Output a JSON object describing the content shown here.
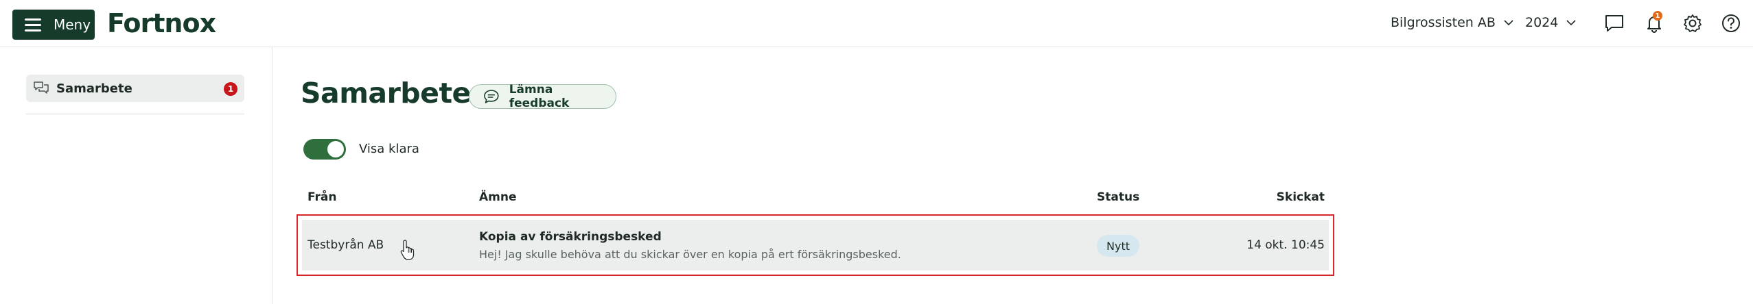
{
  "header": {
    "menu_label": "Meny",
    "logo_text": "Fortnox",
    "company": "Bilgrossisten AB",
    "year": "2024",
    "notification_count": "1",
    "icons": [
      "chat-icon",
      "bell-icon",
      "gear-icon",
      "help-icon"
    ]
  },
  "sidebar": {
    "items": [
      {
        "label": "Samarbete",
        "badge": "1",
        "icon": "chat-bubbles-icon"
      }
    ]
  },
  "main": {
    "title": "Samarbete",
    "feedback_label": "Lämna feedback",
    "toggle": {
      "label": "Visa klara",
      "on": true
    },
    "table": {
      "columns": [
        "Från",
        "Ämne",
        "Status",
        "Skickat"
      ],
      "rows": [
        {
          "from": "Testbyrån AB",
          "subject": "Kopia av försäkringsbesked",
          "preview": "Hej! Jag skulle behöva att du skickar över en kopia på ert försäkringsbesked.",
          "status": "Nytt",
          "sent": "14 okt. 10:45"
        }
      ]
    }
  },
  "colors": {
    "brand": "#163b2a",
    "toggle_on": "#2f6e3d",
    "badge_red": "#c8161d",
    "notif_orange": "#e06a1a",
    "highlight_border": "#d9262c",
    "status_pill": "#d6e8ef"
  }
}
